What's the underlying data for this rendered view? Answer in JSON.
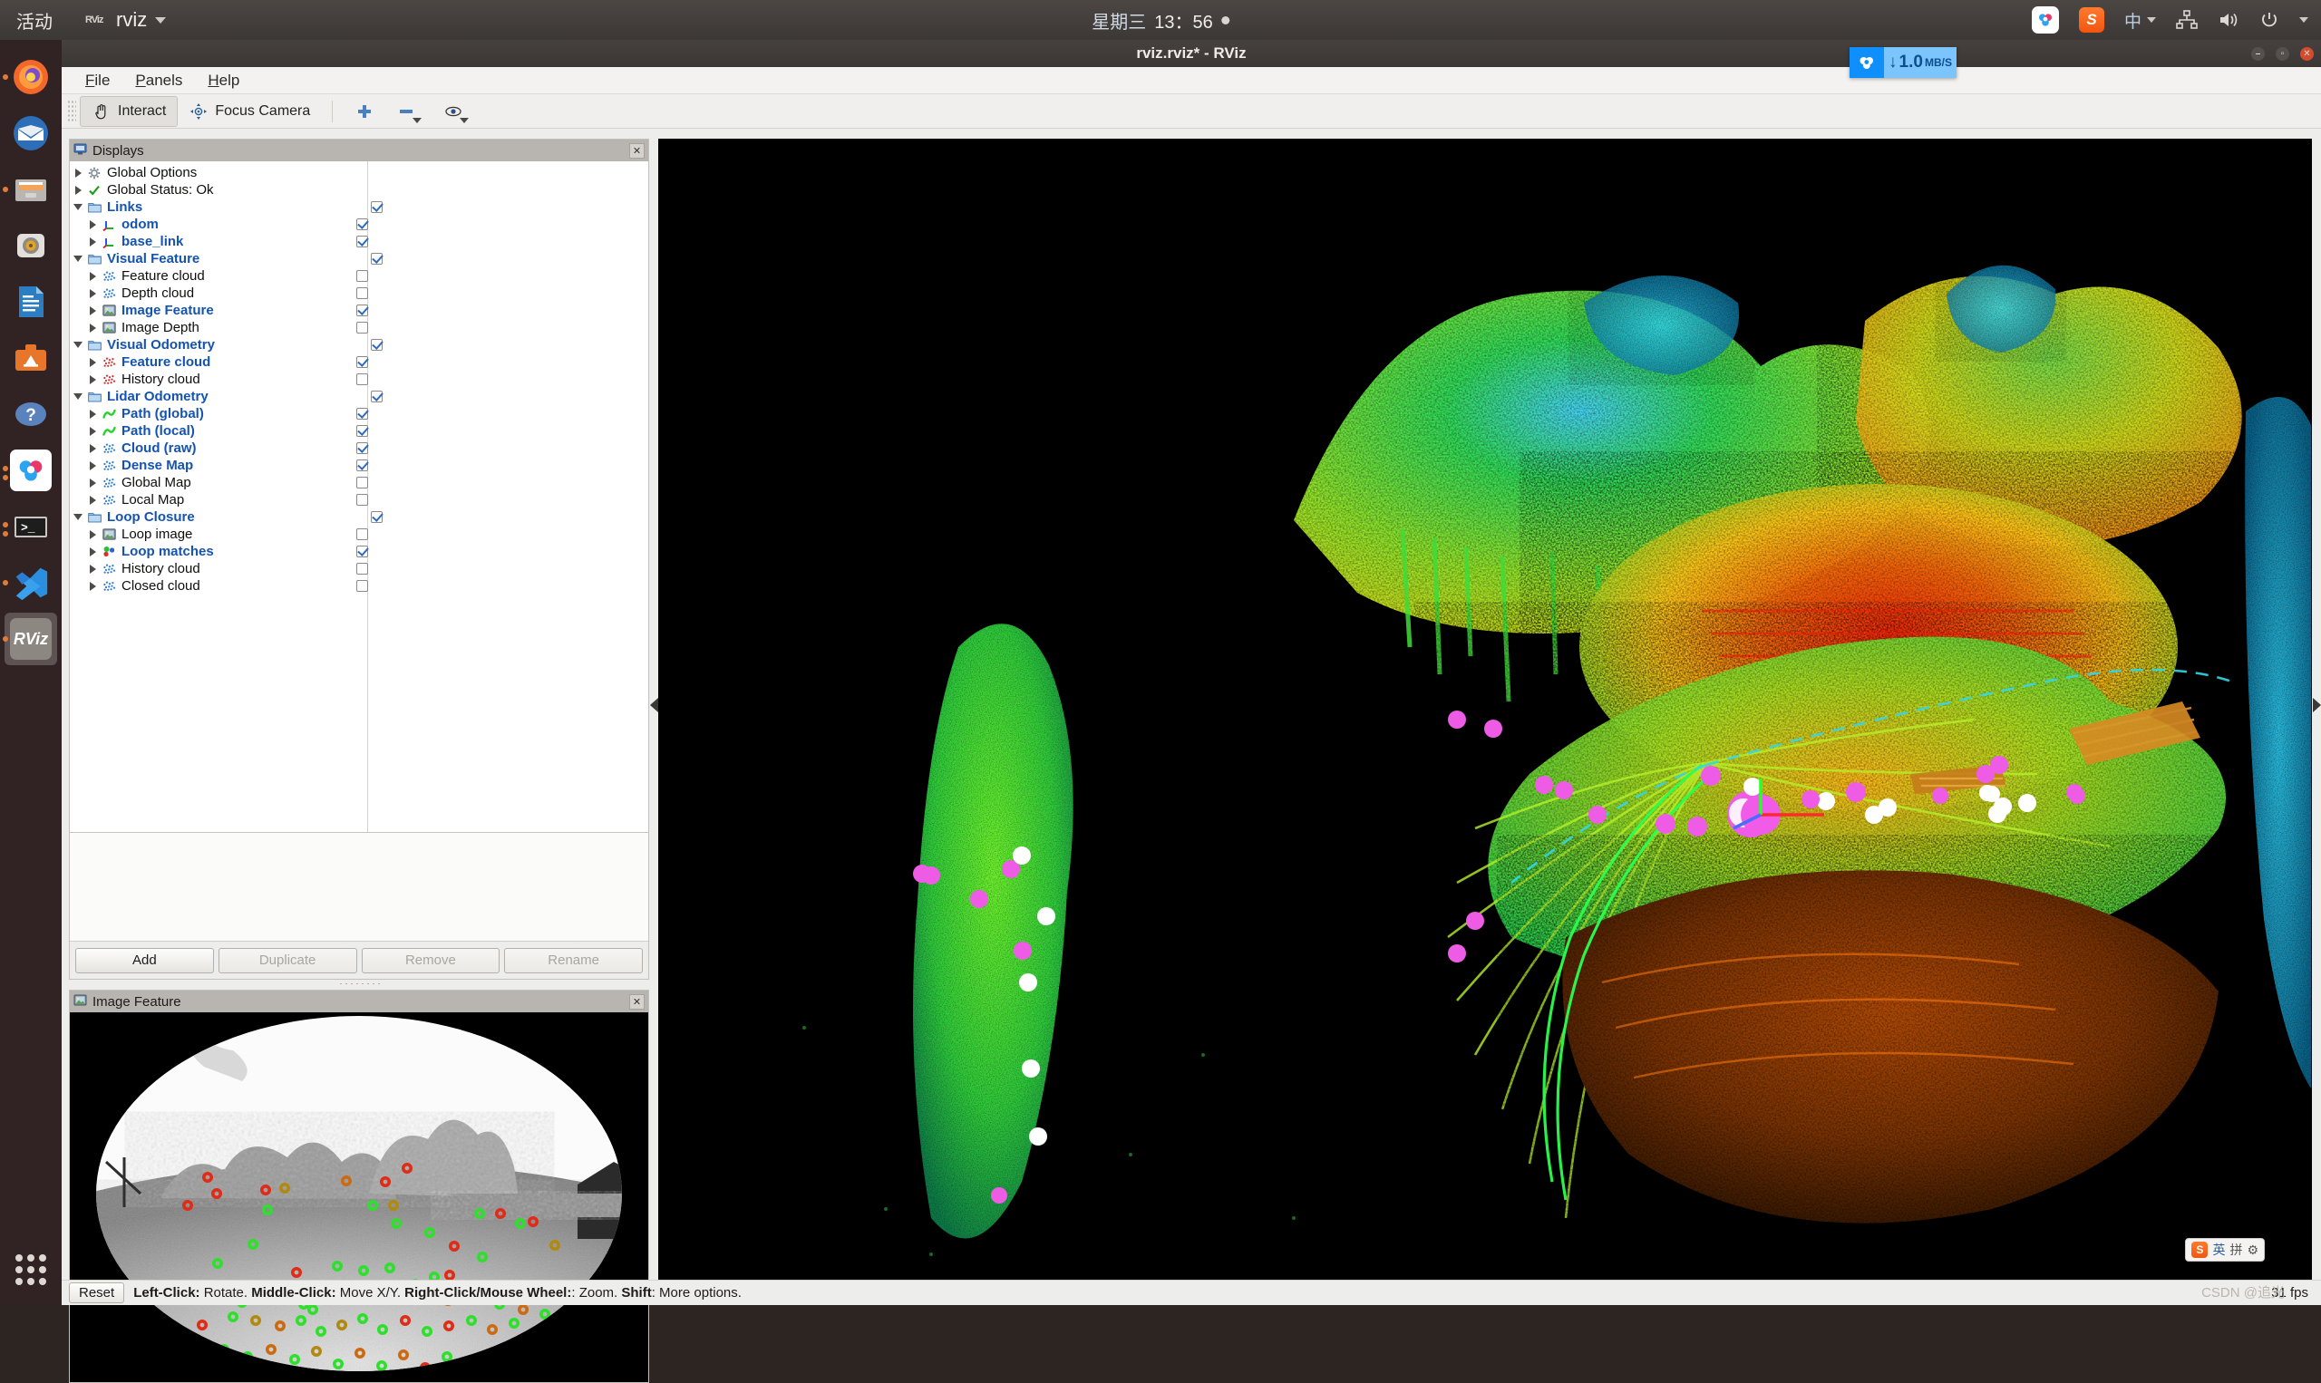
{
  "topbar": {
    "activities": "活动",
    "app_badge": "RViz",
    "app_name": "rviz",
    "clock_day": "星期三",
    "clock_time": "13：56",
    "ime_label": "中",
    "icons": [
      "baidu-netdisk-icon",
      "sogou-input-icon",
      "ime-indicator",
      "network-icon",
      "volume-icon",
      "power-icon"
    ]
  },
  "netspeed": {
    "icon": "baidu-cloud-icon",
    "arrow": "↓",
    "value": "1.0",
    "unit": "MB/S"
  },
  "launcher": {
    "items": [
      {
        "name": "firefox",
        "label": "Firefox",
        "glyph": "",
        "color": "#e8672a"
      },
      {
        "name": "thunderbird",
        "label": "Thunderbird",
        "glyph": "",
        "color": "#2e6fb5"
      },
      {
        "name": "files",
        "label": "Files",
        "glyph": "",
        "color": "#b9b6b1"
      },
      {
        "name": "rhythmbox",
        "label": "Rhythmbox",
        "glyph": "",
        "color": "#d8d6d2"
      },
      {
        "name": "libreoffice-writer",
        "label": "LibreOffice Writer",
        "glyph": "",
        "color": "#2b7ec4"
      },
      {
        "name": "ubuntu-software",
        "label": "Ubuntu Software",
        "glyph": "A",
        "color": "#e6762a"
      },
      {
        "name": "help",
        "label": "Help",
        "glyph": "?",
        "color": "#4a77b8"
      },
      {
        "name": "baidu-netdisk",
        "label": "Baidu Netdisk",
        "glyph": "",
        "color": "#ffffff"
      },
      {
        "name": "terminal",
        "label": "Terminal",
        "glyph": ">_",
        "color": "#2a2a2a"
      },
      {
        "name": "vscode",
        "label": "Visual Studio Code",
        "glyph": "",
        "color": "#2b7cd3"
      },
      {
        "name": "rviz",
        "label": "RViz",
        "glyph": "RViz",
        "color": "#8d8781"
      }
    ],
    "show_apps": "Show Applications"
  },
  "window": {
    "title": "rviz.rviz* - RViz",
    "buttons": [
      "minimize",
      "maximize",
      "close"
    ]
  },
  "menubar": {
    "items": [
      "File",
      "Panels",
      "Help"
    ]
  },
  "toolbar": {
    "interact": "Interact",
    "focus_camera": "Focus Camera",
    "icons": [
      "hand-icon",
      "focus-camera-icon",
      "plus-icon",
      "minus-icon",
      "eye-icon"
    ]
  },
  "displays": {
    "title": "Displays",
    "title_icon": "displays-panel-icon",
    "close_icon": "close-icon",
    "tree": [
      {
        "depth": 0,
        "label": "Global Options",
        "icon": "gear-icon",
        "arrow": "closed",
        "check": null,
        "on": false
      },
      {
        "depth": 0,
        "label": "Global Status: Ok",
        "icon": "check-icon",
        "arrow": "closed",
        "check": null,
        "on": false
      },
      {
        "depth": 0,
        "label": "Links",
        "icon": "folder-icon",
        "arrow": "open",
        "check": true,
        "on": true
      },
      {
        "depth": 1,
        "label": "odom",
        "icon": "axes-icon",
        "arrow": "closed",
        "check": true,
        "on": true
      },
      {
        "depth": 1,
        "label": "base_link",
        "icon": "axes-icon",
        "arrow": "closed",
        "check": true,
        "on": true
      },
      {
        "depth": 0,
        "label": "Visual Feature",
        "icon": "folder-icon",
        "arrow": "open",
        "check": true,
        "on": true
      },
      {
        "depth": 1,
        "label": "Feature cloud",
        "icon": "pointcloud-blue-icon",
        "arrow": "closed",
        "check": false,
        "on": false
      },
      {
        "depth": 1,
        "label": "Depth cloud",
        "icon": "pointcloud-blue-icon",
        "arrow": "closed",
        "check": false,
        "on": false
      },
      {
        "depth": 1,
        "label": "Image Feature",
        "icon": "image-icon",
        "arrow": "closed",
        "check": true,
        "on": true
      },
      {
        "depth": 1,
        "label": "Image Depth",
        "icon": "image-icon",
        "arrow": "closed",
        "check": false,
        "on": false
      },
      {
        "depth": 0,
        "label": "Visual Odometry",
        "icon": "folder-icon",
        "arrow": "open",
        "check": true,
        "on": true
      },
      {
        "depth": 1,
        "label": "Feature cloud",
        "icon": "pointcloud-red-icon",
        "arrow": "closed",
        "check": true,
        "on": true
      },
      {
        "depth": 1,
        "label": "History cloud",
        "icon": "pointcloud-red-icon",
        "arrow": "closed",
        "check": false,
        "on": false
      },
      {
        "depth": 0,
        "label": "Lidar Odometry",
        "icon": "folder-icon",
        "arrow": "open",
        "check": true,
        "on": true
      },
      {
        "depth": 1,
        "label": "Path (global)",
        "icon": "path-icon",
        "arrow": "closed",
        "check": true,
        "on": true
      },
      {
        "depth": 1,
        "label": "Path (local)",
        "icon": "path-icon",
        "arrow": "closed",
        "check": true,
        "on": true
      },
      {
        "depth": 1,
        "label": "Cloud (raw)",
        "icon": "pointcloud-blue-icon",
        "arrow": "closed",
        "check": true,
        "on": true
      },
      {
        "depth": 1,
        "label": "Dense Map",
        "icon": "pointcloud-blue-icon",
        "arrow": "closed",
        "check": true,
        "on": true
      },
      {
        "depth": 1,
        "label": "Global Map",
        "icon": "pointcloud-blue-icon",
        "arrow": "closed",
        "check": false,
        "on": false
      },
      {
        "depth": 1,
        "label": "Local Map",
        "icon": "pointcloud-blue-icon",
        "arrow": "closed",
        "check": false,
        "on": false
      },
      {
        "depth": 0,
        "label": "Loop Closure",
        "icon": "folder-icon",
        "arrow": "open",
        "check": true,
        "on": true
      },
      {
        "depth": 1,
        "label": "Loop image",
        "icon": "image-icon",
        "arrow": "closed",
        "check": false,
        "on": false
      },
      {
        "depth": 1,
        "label": "Loop matches",
        "icon": "markers-icon",
        "arrow": "closed",
        "check": true,
        "on": true
      },
      {
        "depth": 1,
        "label": "History cloud",
        "icon": "pointcloud-blue-icon",
        "arrow": "closed",
        "check": false,
        "on": false
      },
      {
        "depth": 1,
        "label": "Closed cloud",
        "icon": "pointcloud-blue-icon",
        "arrow": "closed",
        "check": false,
        "on": false
      }
    ],
    "buttons": [
      {
        "label": "Add",
        "enabled": true
      },
      {
        "label": "Duplicate",
        "enabled": false
      },
      {
        "label": "Remove",
        "enabled": false
      },
      {
        "label": "Rename",
        "enabled": false
      }
    ]
  },
  "image_panel": {
    "title": "Image Feature",
    "title_icon": "image-icon",
    "close_icon": "close-icon"
  },
  "statusbar": {
    "reset": "Reset",
    "hint_parts": [
      {
        "t": "Left-Click:",
        "b": true
      },
      {
        "t": " Rotate. ",
        "b": false
      },
      {
        "t": "Middle-Click:",
        "b": true
      },
      {
        "t": " Move X/Y. ",
        "b": false
      },
      {
        "t": "Right-Click/Mouse Wheel:",
        "b": true
      },
      {
        "t": ": Zoom. ",
        "b": false
      },
      {
        "t": "Shift",
        "b": true
      },
      {
        "t": ": More options.",
        "b": false
      }
    ],
    "fps": "31 fps",
    "watermark": "CSDN @追光"
  },
  "sogou_float": {
    "logo": "S",
    "mode": "英",
    "pinyin": "拼",
    "gear": "⚙"
  }
}
